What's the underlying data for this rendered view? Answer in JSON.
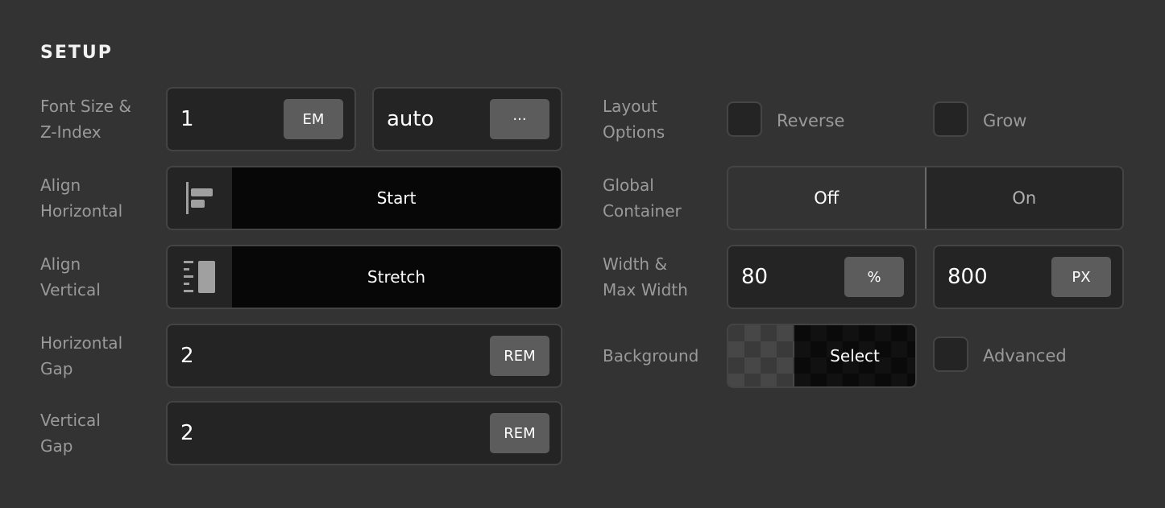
{
  "section_title": "SETUP",
  "left": {
    "font_size": {
      "label_line1": "Font Size &",
      "label_line2": "Z-Index",
      "font_size_value": "1",
      "font_size_unit": "EM",
      "z_index_value": "auto",
      "z_index_menu": "···",
      "z_index_menu_icon": "more-icon"
    },
    "align_horizontal": {
      "label_line1": "Align",
      "label_line2": "Horizontal",
      "icon": "align-start-icon",
      "value": "Start"
    },
    "align_vertical": {
      "label_line1": "Align",
      "label_line2": "Vertical",
      "icon": "align-stretch-icon",
      "value": "Stretch"
    },
    "horizontal_gap": {
      "label_line1": "Horizontal",
      "label_line2": "Gap",
      "value": "2",
      "unit": "REM"
    },
    "vertical_gap": {
      "label_line1": "Vertical",
      "label_line2": "Gap",
      "value": "2",
      "unit": "REM"
    }
  },
  "right": {
    "layout_options": {
      "label_line1": "Layout",
      "label_line2": "Options",
      "reverse_label": "Reverse",
      "reverse_checked": false,
      "grow_label": "Grow",
      "grow_checked": false
    },
    "global_container": {
      "label_line1": "Global",
      "label_line2": "Container",
      "options": [
        "Off",
        "On"
      ],
      "selected": "Off"
    },
    "width": {
      "label_line1": "Width &",
      "label_line2": "Max Width",
      "width_value": "80",
      "width_unit": "%",
      "max_width_value": "800",
      "max_width_unit": "PX"
    },
    "background": {
      "label": "Background",
      "select_label": "Select",
      "advanced_label": "Advanced",
      "advanced_checked": false
    }
  }
}
